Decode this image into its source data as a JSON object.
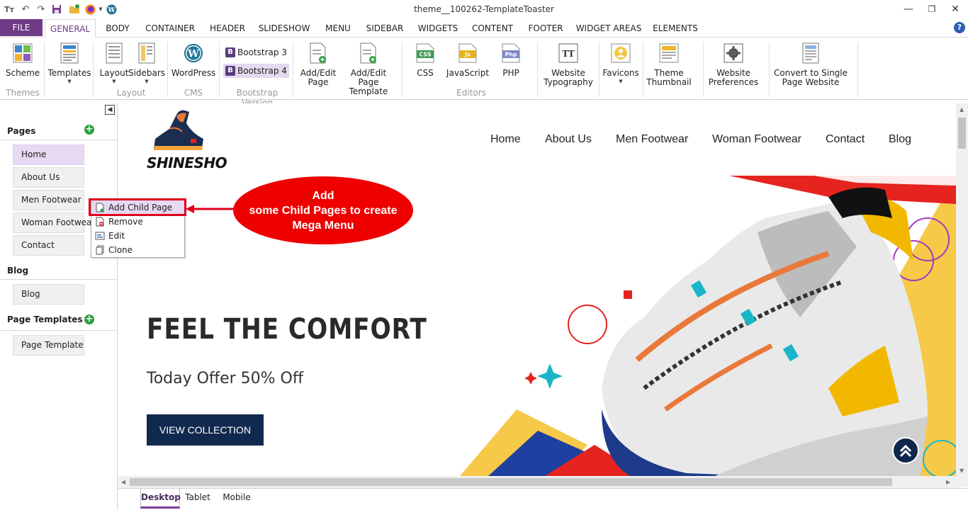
{
  "window": {
    "title": "theme__100262-TemplateToaster"
  },
  "tabs": [
    "FILE",
    "GENERAL",
    "BODY",
    "CONTAINER",
    "HEADER",
    "SLIDESHOW",
    "MENU",
    "SIDEBAR",
    "WIDGETS",
    "CONTENT",
    "FOOTER",
    "WIDGET AREAS",
    "ELEMENTS"
  ],
  "active_tab": "GENERAL",
  "ribbon": {
    "scheme": "Scheme",
    "templates": "Templates",
    "layout": "Layout",
    "sidebars": "Sidebars",
    "wordpress": "WordPress",
    "bootstrap3": "Bootstrap 3",
    "bootstrap4": "Bootstrap 4",
    "add_edit_page": "Add/Edit\nPage",
    "add_edit_template": "Add/Edit Page\nTemplate",
    "css": "CSS",
    "javascript": "JavaScript",
    "php": "PHP",
    "typography": "Website\nTypography",
    "favicons": "Favicons",
    "thumbnail": "Theme\nThumbnail",
    "preferences": "Website\nPreferences",
    "convert": "Convert to Single\nPage Website",
    "groups": {
      "themes": "Themes",
      "layout": "Layout",
      "cms": "CMS",
      "bootstrap_version": "Bootstrap Version",
      "editors": "Editors"
    },
    "icon_text": {
      "css": "CSS",
      "js": "Js",
      "php": "Php",
      "b": "B",
      "tt": "TT"
    }
  },
  "left_pane": {
    "pages_title": "Pages",
    "pages": [
      "Home",
      "About Us",
      "Men Footwear",
      "Woman Footwear",
      "Contact"
    ],
    "blog_title": "Blog",
    "blog_items": [
      "Blog"
    ],
    "templates_title": "Page Templates",
    "template_items": [
      "Page Template"
    ]
  },
  "context_menu": [
    "Add Child Page",
    "Remove",
    "Edit",
    "Clone"
  ],
  "callout": {
    "line1": "Add",
    "line2": "some Child Pages to create",
    "line3": "Mega Menu"
  },
  "preview": {
    "logo": "SHINESHO",
    "nav": [
      "Home",
      "About Us",
      "Men Footwear",
      "Woman Footwear",
      "Contact",
      "Blog"
    ],
    "hero_title": "FEEL THE COMFORT",
    "hero_sub": "Today Offer 50% Off",
    "hero_button": "VIEW COLLECTION"
  },
  "bottom_tabs": [
    "Desktop",
    "Tablet",
    "Mobile"
  ],
  "colors": {
    "accent": "#6f3a86",
    "callout": "#ee0000",
    "hero_button": "#12294f"
  }
}
